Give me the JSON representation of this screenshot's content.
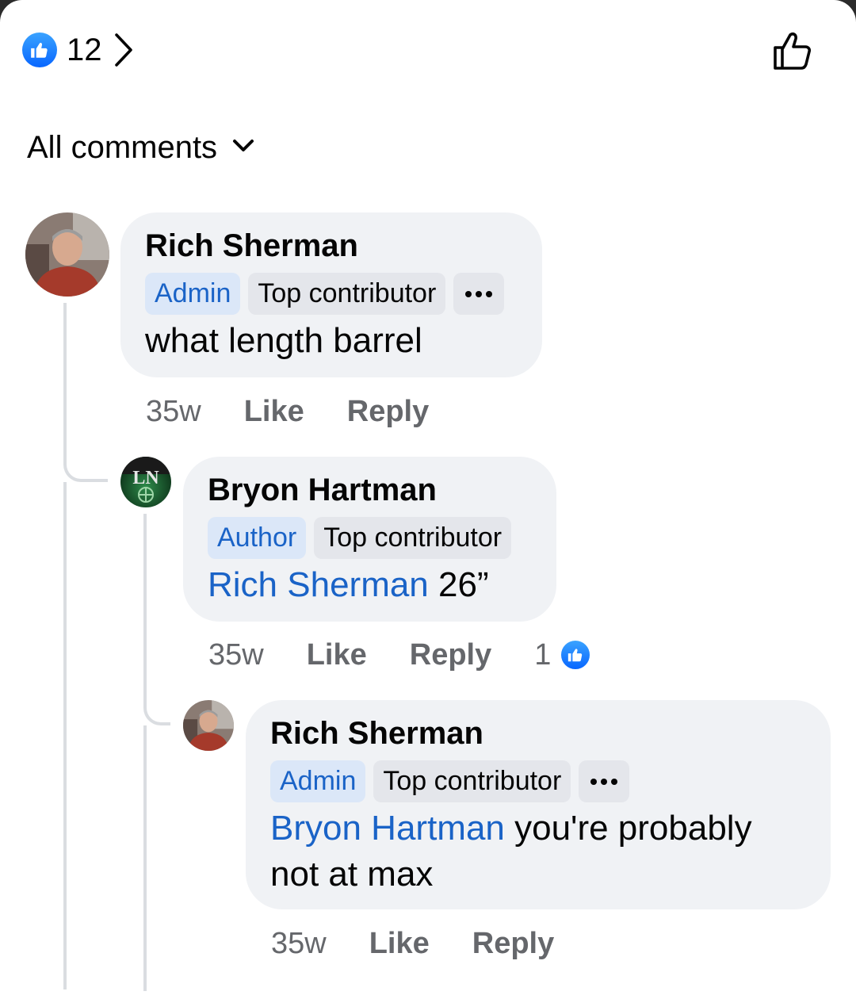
{
  "header": {
    "reaction_count": "12",
    "filter_label": "All comments"
  },
  "comments": [
    {
      "author": "Rich Sherman",
      "badges": [
        "Admin",
        "Top contributor"
      ],
      "text": "what length barrel",
      "time": "35w",
      "like_label": "Like",
      "reply_label": "Reply"
    },
    {
      "author": "Bryon Hartman",
      "badges": [
        "Author",
        "Top contributor"
      ],
      "mention": "Rich Sherman",
      "text": " 26”",
      "time": "35w",
      "like_label": "Like",
      "reply_label": "Reply",
      "like_count": "1"
    },
    {
      "author": "Rich Sherman",
      "badges": [
        "Admin",
        "Top contributor"
      ],
      "mention": "Bryon Hartman",
      "text": " you're probably not at max",
      "time": "35w",
      "like_label": "Like",
      "reply_label": "Reply"
    }
  ],
  "colors": {
    "accent": "#0866ff",
    "mention": "#1a63c7",
    "bubble": "#f0f2f5",
    "muted": "#65676b"
  },
  "icons": [
    "thumbs-up-icon",
    "chevron-right-icon",
    "thumbs-up-outline-icon",
    "chevron-down-icon",
    "more-dots-icon"
  ]
}
